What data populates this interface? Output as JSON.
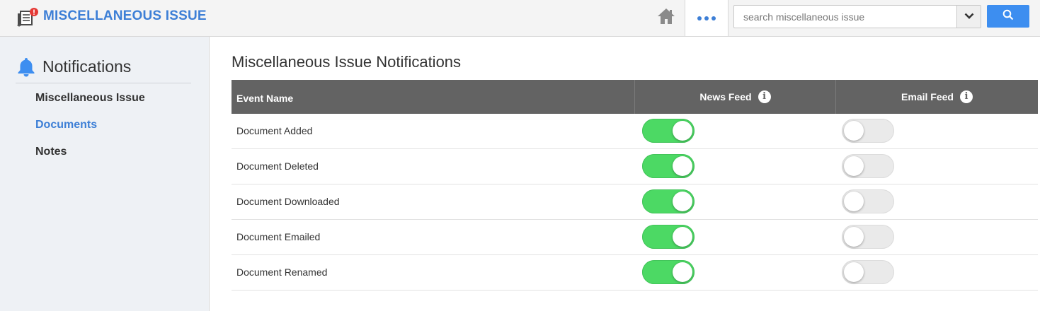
{
  "header": {
    "app_title": "MISCELLANEOUS ISSUE",
    "app_icon": "document-alert-icon",
    "home_icon": "home-icon",
    "more_icon": "more-dots-icon",
    "search_placeholder": "search miscellaneous issue",
    "search_value": "",
    "search_icon": "search-icon",
    "dropdown_icon": "chevron-down-icon"
  },
  "sidebar": {
    "title": "Notifications",
    "title_icon": "bell-icon",
    "items": [
      {
        "label": "Miscellaneous Issue",
        "active": false
      },
      {
        "label": "Documents",
        "active": true
      },
      {
        "label": "Notes",
        "active": false
      }
    ]
  },
  "main": {
    "title": "Miscellaneous Issue Notifications",
    "columns": {
      "event": "Event Name",
      "news": "News Feed",
      "email": "Email Feed"
    },
    "rows": [
      {
        "name": "Document Added",
        "news_feed": true,
        "email_feed": false
      },
      {
        "name": "Document Deleted",
        "news_feed": true,
        "email_feed": false
      },
      {
        "name": "Document Downloaded",
        "news_feed": true,
        "email_feed": false
      },
      {
        "name": "Document Emailed",
        "news_feed": true,
        "email_feed": false
      },
      {
        "name": "Document Renamed",
        "news_feed": true,
        "email_feed": false
      }
    ]
  },
  "colors": {
    "accent": "#3d7fd6",
    "toggle_on": "#4cd964",
    "toggle_off": "#eaeaea",
    "table_header": "#636363"
  }
}
